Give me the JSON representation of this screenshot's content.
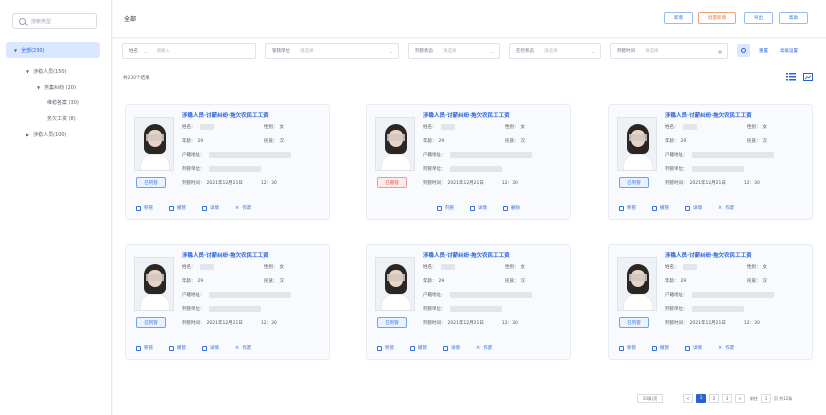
{
  "sidebar": {
    "search_placeholder": "搜索类型",
    "tree": [
      {
        "label": "全部(230)",
        "arrow": "▼"
      },
      {
        "label": "涉稳人员(150)",
        "arrow": "▼"
      },
      {
        "label": "务集纠纷 (20)",
        "arrow": "▼"
      },
      {
        "label": "维稳各案 (30)",
        "arrow": ""
      },
      {
        "label": "务欠工资 (8)",
        "arrow": ""
      },
      {
        "label": "涉稳人员(100)",
        "arrow": "▶"
      }
    ]
  },
  "header": {
    "title": "全部",
    "buttons": {
      "add": "新增",
      "batch": "批量新增",
      "export": "导出",
      "help": "帮助"
    }
  },
  "filters": {
    "name_label": "姓名",
    "name_placeholder": "请输入",
    "unit_label": "管辖单位",
    "unit_placeholder": "请选择",
    "list_status_label": "列管状态",
    "list_status_placeholder": "请选择",
    "control_status_label": "在控状态",
    "control_status_placeholder": "请选择",
    "list_time_label": "列管时间",
    "list_time_placeholder": "请选择",
    "reset": "重置",
    "advanced": "高级设置"
  },
  "summary": {
    "count_text": "共230个结果"
  },
  "cards": [
    {
      "title": "涉稳人员·讨薪纠纷·拖欠农民工工资",
      "name_label": "姓名：",
      "gender_label": "性别：",
      "gender": "女",
      "age_label": "年龄：",
      "age": "29",
      "nation_label": "民族：",
      "nation": "汉",
      "addr_label": "户籍地址：",
      "unit_label": "列管单位：",
      "time_label": "列管时间：",
      "time": "2021年12月21日",
      "clock": "12：30",
      "status": "已列管",
      "status_type": "blue",
      "actions": [
        "移管",
        "撤管",
        "详情",
        "作废"
      ]
    },
    {
      "title": "涉稳人员·讨薪纠纷·拖欠农民工工资",
      "name_label": "姓名：",
      "gender_label": "性别：",
      "gender": "女",
      "age_label": "年龄：",
      "age": "29",
      "nation_label": "民族：",
      "nation": "汉",
      "addr_label": "户籍地址：",
      "unit_label": "列管单位：",
      "time_label": "列管时间：",
      "time": "2021年12月21日",
      "clock": "12：30",
      "status": "已撤管",
      "status_type": "red",
      "actions": [
        "列管",
        "详情",
        "删除"
      ]
    },
    {
      "title": "涉稳人员·讨薪纠纷·拖欠农民工工资",
      "name_label": "姓名：",
      "gender_label": "性别：",
      "gender": "女",
      "age_label": "年龄：",
      "age": "29",
      "nation_label": "民族：",
      "nation": "汉",
      "addr_label": "户籍地址：",
      "unit_label": "列管单位：",
      "time_label": "列管时间：",
      "time": "2021年12月21日",
      "clock": "12：30",
      "status": "已列管",
      "status_type": "blue",
      "actions": [
        "移管",
        "撤管",
        "详情",
        "作废"
      ]
    },
    {
      "title": "涉稳人员·讨薪纠纷·拖欠农民工工资",
      "name_label": "姓名：",
      "gender_label": "性别：",
      "gender": "女",
      "age_label": "年龄：",
      "age": "29",
      "nation_label": "民族：",
      "nation": "汉",
      "addr_label": "户籍地址：",
      "unit_label": "列管单位：",
      "time_label": "列管时间：",
      "time": "2021年12月21日",
      "clock": "12：30",
      "status": "已列管",
      "status_type": "blue",
      "actions": [
        "移管",
        "撤管",
        "详情",
        "作废"
      ]
    },
    {
      "title": "涉稳人员·讨薪纠纷·拖欠农民工工资",
      "name_label": "姓名：",
      "gender_label": "性别：",
      "gender": "女",
      "age_label": "年龄：",
      "age": "29",
      "nation_label": "民族：",
      "nation": "汉",
      "addr_label": "户籍地址：",
      "unit_label": "列管单位：",
      "time_label": "列管时间：",
      "time": "2021年12月21日",
      "clock": "12：30",
      "status": "已列管",
      "status_type": "blue",
      "actions": [
        "移管",
        "撤管",
        "详情",
        "作废"
      ]
    },
    {
      "title": "涉稳人员·讨薪纠纷·拖欠农民工工资",
      "name_label": "姓名：",
      "gender_label": "性别：",
      "gender": "女",
      "age_label": "年龄：",
      "age": "29",
      "nation_label": "民族：",
      "nation": "汉",
      "addr_label": "户籍地址：",
      "unit_label": "列管单位：",
      "time_label": "列管时间：",
      "time": "2021年12月21日",
      "clock": "12：30",
      "status": "已列管",
      "status_type": "blue",
      "actions": [
        "移管",
        "撤管",
        "详情",
        "作废"
      ]
    }
  ],
  "pagination": {
    "page_size": "10条/页",
    "prev": "<",
    "pages": [
      "1",
      "2",
      "3"
    ],
    "current_page": "1",
    "next": ">",
    "goto_label": "前往",
    "goto_value": "1",
    "total_label": "页 共12条"
  },
  "colors": {
    "primary": "#2a62d6",
    "danger": "#e05353",
    "orange": "#e9713a"
  }
}
